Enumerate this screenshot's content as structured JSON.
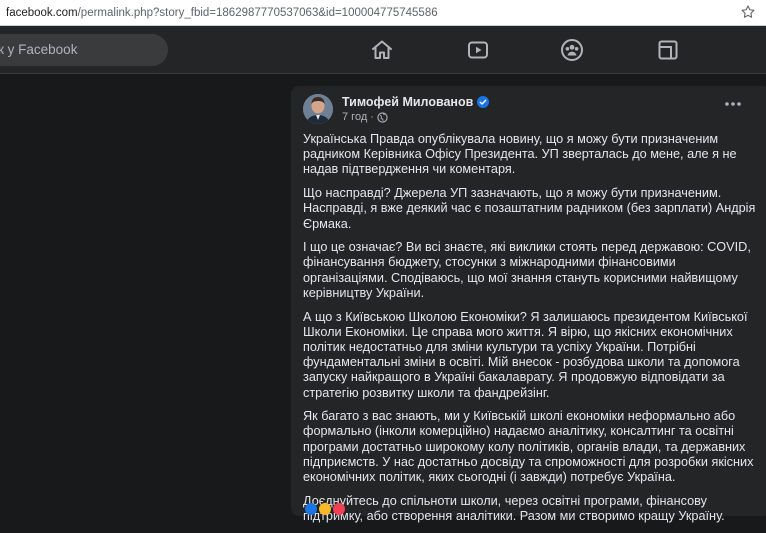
{
  "browser": {
    "url_host": "facebook.com",
    "url_path": "/permalink.php?story_fbid=1862987770537063&id=100004775745586"
  },
  "topnav": {
    "search_placeholder": "к у Facebook",
    "icons": [
      "home-icon",
      "watch-icon",
      "groups-icon",
      "gaming-icon"
    ]
  },
  "post": {
    "author": "Тимофей Милованов",
    "time": "7 год",
    "paragraphs": [
      "Українська Правда опублікувала новину, що я можу бути призначеним радником Керівника Офісу Президента. УП зверталась до мене, але я не надав підтвердження чи коментаря.",
      "Що насправді? Джерела УП зазначають, що я можу бути призначеним. Насправді, я вже деякий час є позаштатним радником (без зарплати) Андрія Єрмака.",
      "І що це означає? Ви всі знаєте, які виклики стоять перед державою: COVID, фінансування бюджету, стосунки з міжнародними фінансовими організаціями. Сподіваюсь, що мої знання стануть корисними найвищому керівництву України.",
      "А що з Київською Школою Економіки? Я залишаюсь президентом Київської Школи Економіки. Це справа мого життя. Я вірю, що якісних економічних політик недостатньо для зміни культури та успіху України. Потрібні фундаментальні зміни в освіті. Мій внесок - розбудова школи та допомога запуску найкращого в Україні бакалаврату. Я продовжую відповідати за стратегію розвитку школи та фандрейзінг.",
      "Як багато з вас знають, ми у Київській школі економіки неформально або формально (інколи комерційно) надаємо аналітику, консалтинг та освітні програми достатньо широкому колу політиків, органів влади, та державних підприємств. У нас достатньо досвіду та спроможності для розробки якісних економічних політик, яких сьогодні (і завжди) потребує Україна.",
      "Доєднуйтесь до спільноти школи, через освітні програми, фінансову підтримку, або створення аналітики. Разом ми створимо кращу Україну."
    ]
  },
  "colors": {
    "page_bg": "#18191a",
    "card_bg": "#242526",
    "text_primary": "#e4e6eb",
    "text_secondary": "#b0b3b8",
    "verified_blue": "#1b74e4"
  }
}
